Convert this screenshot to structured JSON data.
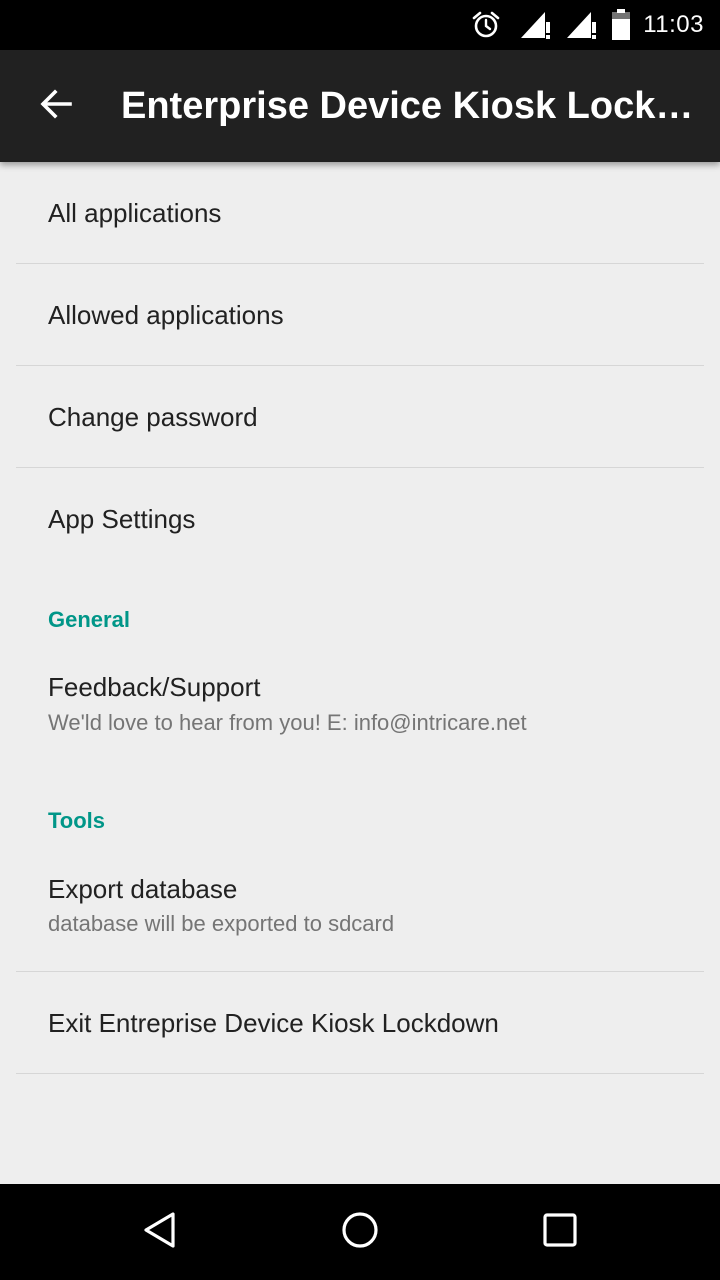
{
  "status_bar": {
    "time": "11:03",
    "icons": [
      "alarm-icon",
      "signal-icon",
      "signal-icon",
      "battery-icon"
    ]
  },
  "toolbar": {
    "title": "Enterprise Device Kiosk LockD…",
    "back_icon": "arrow-back-icon"
  },
  "menu": {
    "all_applications": "All applications",
    "allowed_applications": "Allowed applications",
    "change_password": "Change password",
    "app_settings": "App Settings"
  },
  "general": {
    "header": "General",
    "feedback_title": "Feedback/Support",
    "feedback_summary": "We'ld love to hear from you! E: info@intricare.net"
  },
  "tools": {
    "header": "Tools",
    "export_title": "Export database",
    "export_summary": "database will be exported to sdcard",
    "exit_title": "Exit Entreprise Device Kiosk Lockdown"
  },
  "colors": {
    "accent": "#009688",
    "toolbar": "#212121",
    "background": "#eeeeee"
  },
  "nav_bar": {
    "icons": [
      "back-triangle-icon",
      "home-circle-icon",
      "recents-square-icon"
    ]
  }
}
